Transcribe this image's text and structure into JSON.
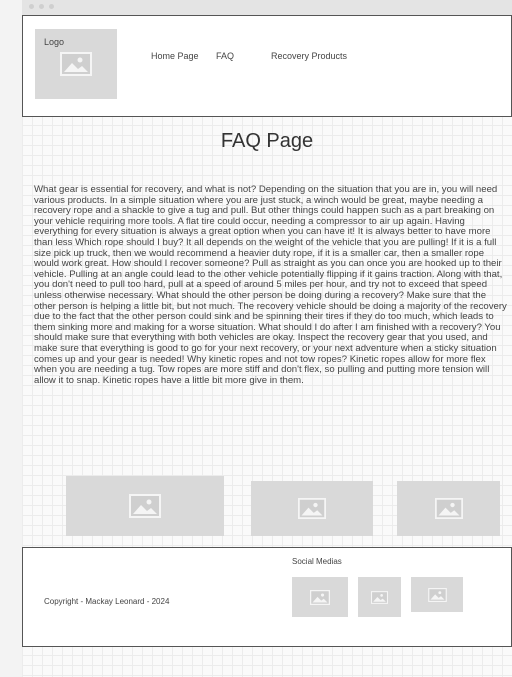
{
  "header": {
    "logo_label": "Logo",
    "nav": {
      "home": "Home Page",
      "faq": "FAQ",
      "products": "Recovery Products"
    }
  },
  "main": {
    "title": "FAQ Page",
    "body": "What gear is essential for recovery, and what is not? Depending on the situation that you are in, you will need various products. In a simple situation where you are just stuck, a winch would be great, maybe needing a recovery rope and a shackle to give a tug and pull. But other things could happen such as a part breaking on your vehicle requiring more tools. A flat tire could occur, needing a compressor to air up again. Having everything for every situation is always a great option when you can have it! It is always better to have more than less Which rope should I buy? It all depends on the weight of the vehicle that you are pulling! If it is a full size pick up truck, then we would recommend a heavier duty rope, if it is a smaller car, then a smaller rope would work great. How should I recover someone? Pull as straight as you can once you are hooked up to their vehicle. Pulling at an angle could lead to the other vehicle potentially flipping if it gains traction. Along with that, you don't need to pull too hard, pull at a speed of around 5 miles per hour, and try not to exceed that speed unless otherwise necessary. What should the other person be doing during a recovery? Make sure that the other person is helping a little bit, but not much. The recovery vehicle should be doing a majority of the recovery due to the fact that the other person could sink and be spinning their tires if they do too much, which leads to them sinking more and making for a worse situation. What should I do after I am finished with a recovery? You should make sure that everything with both vehicles are okay. Inspect the recovery gear that you used, and make sure that everything is good to go for your next recovery, or your next adventure when a sticky situation comes up and your gear is needed! Why kinetic ropes and not tow ropes? Kinetic ropes allow for more flex when you are needing a tug. Tow ropes are more stiff and don't flex, so pulling and putting more tension will allow it to snap. Kinetic ropes have a little bit more give in them."
  },
  "footer": {
    "copyright": "Copyright - Mackay Leonard - 2024",
    "social_label": "Social Medias"
  },
  "icons": {
    "image_placeholder": "image-placeholder-icon"
  },
  "colors": {
    "placeholder": "#d9d9d9",
    "placeholder_icon": "#f5f5f5",
    "border": "#555555"
  }
}
